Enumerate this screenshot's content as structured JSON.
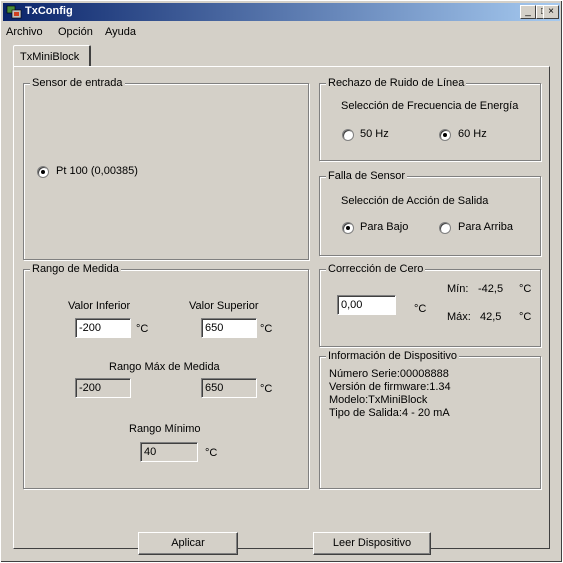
{
  "window": {
    "title": "TxConfig",
    "caption_buttons": {
      "minimize": "_",
      "maximize": "□",
      "close": "×"
    }
  },
  "menu": [
    {
      "label": "Archivo"
    },
    {
      "label": "Opción"
    },
    {
      "label": "Ayuda"
    }
  ],
  "tab": {
    "label": "TxMiniBlock"
  },
  "sensor": {
    "title": "Sensor de entrada",
    "option": "Pt 100 (0,00385)",
    "selected": true
  },
  "noise": {
    "title": "Rechazo de Ruido de Línea",
    "subtitle": "Selección de Frecuencia de Energía",
    "options": [
      "50 Hz",
      "60 Hz"
    ],
    "selected": "60 Hz"
  },
  "fault": {
    "title": "Falla de Sensor",
    "subtitle": "Selección de Acción de Salida",
    "options": [
      "Para Bajo",
      "Para Arriba"
    ],
    "selected": "Para Bajo"
  },
  "range": {
    "title": "Rango de Medida",
    "lower_label": "Valor Inferior",
    "upper_label": "Valor Superior",
    "lower_value": "-200",
    "upper_value": "650",
    "unit": "°C",
    "max_range_label": "Rango Máx de Medida",
    "max_lower": "-200",
    "max_upper": "650",
    "min_range_label": "Rango Mínimo",
    "min_value": "40"
  },
  "zero": {
    "title": "Corrección de Cero",
    "value": "0,00",
    "unit": "°C",
    "min_label": "Mín:",
    "min_value": "-42,5",
    "max_label": "Máx:",
    "max_value": "42,5"
  },
  "device": {
    "title": "Información de Dispositivo",
    "lines": [
      "Número Serie:00008888",
      "Versión de firmware:1.34",
      "Modelo:TxMiniBlock",
      "Tipo de Salida:4 - 20 mA"
    ]
  },
  "buttons": {
    "apply": "Aplicar",
    "read": "Leer Dispositivo"
  }
}
